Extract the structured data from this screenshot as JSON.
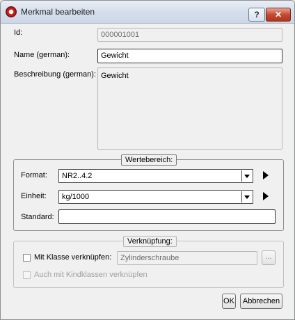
{
  "window": {
    "title": "Merkmal bearbeiten",
    "help_label": "?",
    "close_label": "✕"
  },
  "fields": {
    "id_label": "Id:",
    "id_value": "000001001",
    "name_label": "Name (german):",
    "name_value": "Gewicht",
    "desc_label": "Beschreibung (german):",
    "desc_value": "Gewicht"
  },
  "wertebereich": {
    "title": "Wertebereich:",
    "format_label": "Format:",
    "format_value": "NR2..4.2",
    "einheit_label": "Einheit:",
    "einheit_value": "kg/1000",
    "standard_label": "Standard:",
    "standard_value": ""
  },
  "verknuepfung": {
    "title": "Verknüpfung:",
    "klasse_label": "Mit Klasse verknüpfen:",
    "klasse_value": "Zylinderschraube",
    "browse_label": "...",
    "kind_label": "Auch mit Kindklassen verknüpfen"
  },
  "buttons": {
    "ok": "OK",
    "cancel": "Abbrechen"
  },
  "icons": {
    "app": "app-icon",
    "format_more": "triangle-right-icon",
    "einheit_more": "triangle-right-icon"
  }
}
